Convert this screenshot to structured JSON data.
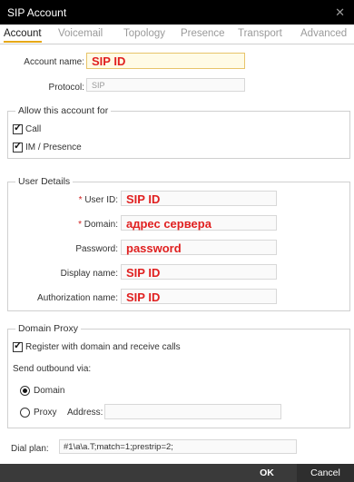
{
  "window": {
    "title": "SIP Account",
    "close_glyph": "✕"
  },
  "tabs": [
    {
      "label": "Account",
      "active": true
    },
    {
      "label": "Voicemail"
    },
    {
      "label": "Topology"
    },
    {
      "label": "Presence"
    },
    {
      "label": "Transport"
    },
    {
      "label": "Advanced"
    }
  ],
  "account": {
    "name_label": "Account name:",
    "name_value": "SIP ID",
    "protocol_label": "Protocol:",
    "protocol_value": "SIP"
  },
  "allow": {
    "legend": "Allow this account for",
    "call_label": "Call",
    "call_checked": true,
    "im_label": "IM / Presence",
    "im_checked": true
  },
  "user": {
    "legend": "User Details",
    "required_mark": "*",
    "userid_label": "User ID:",
    "userid_value": "SIP ID",
    "domain_label": "Domain:",
    "domain_value": "адрес сервера",
    "password_label": "Password:",
    "password_value": "password",
    "display_label": "Display name:",
    "display_value": "SIP ID",
    "auth_label": "Authorization name:",
    "auth_value": "SIP ID"
  },
  "proxy": {
    "legend": "Domain Proxy",
    "register_label": "Register with domain and receive calls",
    "register_checked": true,
    "send_via_label": "Send outbound via:",
    "domain_option": "Domain",
    "domain_selected": true,
    "proxy_option": "Proxy",
    "address_label": "Address:",
    "address_value": ""
  },
  "dialplan": {
    "label": "Dial plan:",
    "value": "#1\\a\\a.T;match=1;prestrip=2;"
  },
  "buttons": {
    "ok": "OK",
    "cancel": "Cancel"
  },
  "colors": {
    "accent": "#e6a817",
    "annotation": "#e02020",
    "footer": "#3a3a3a"
  }
}
